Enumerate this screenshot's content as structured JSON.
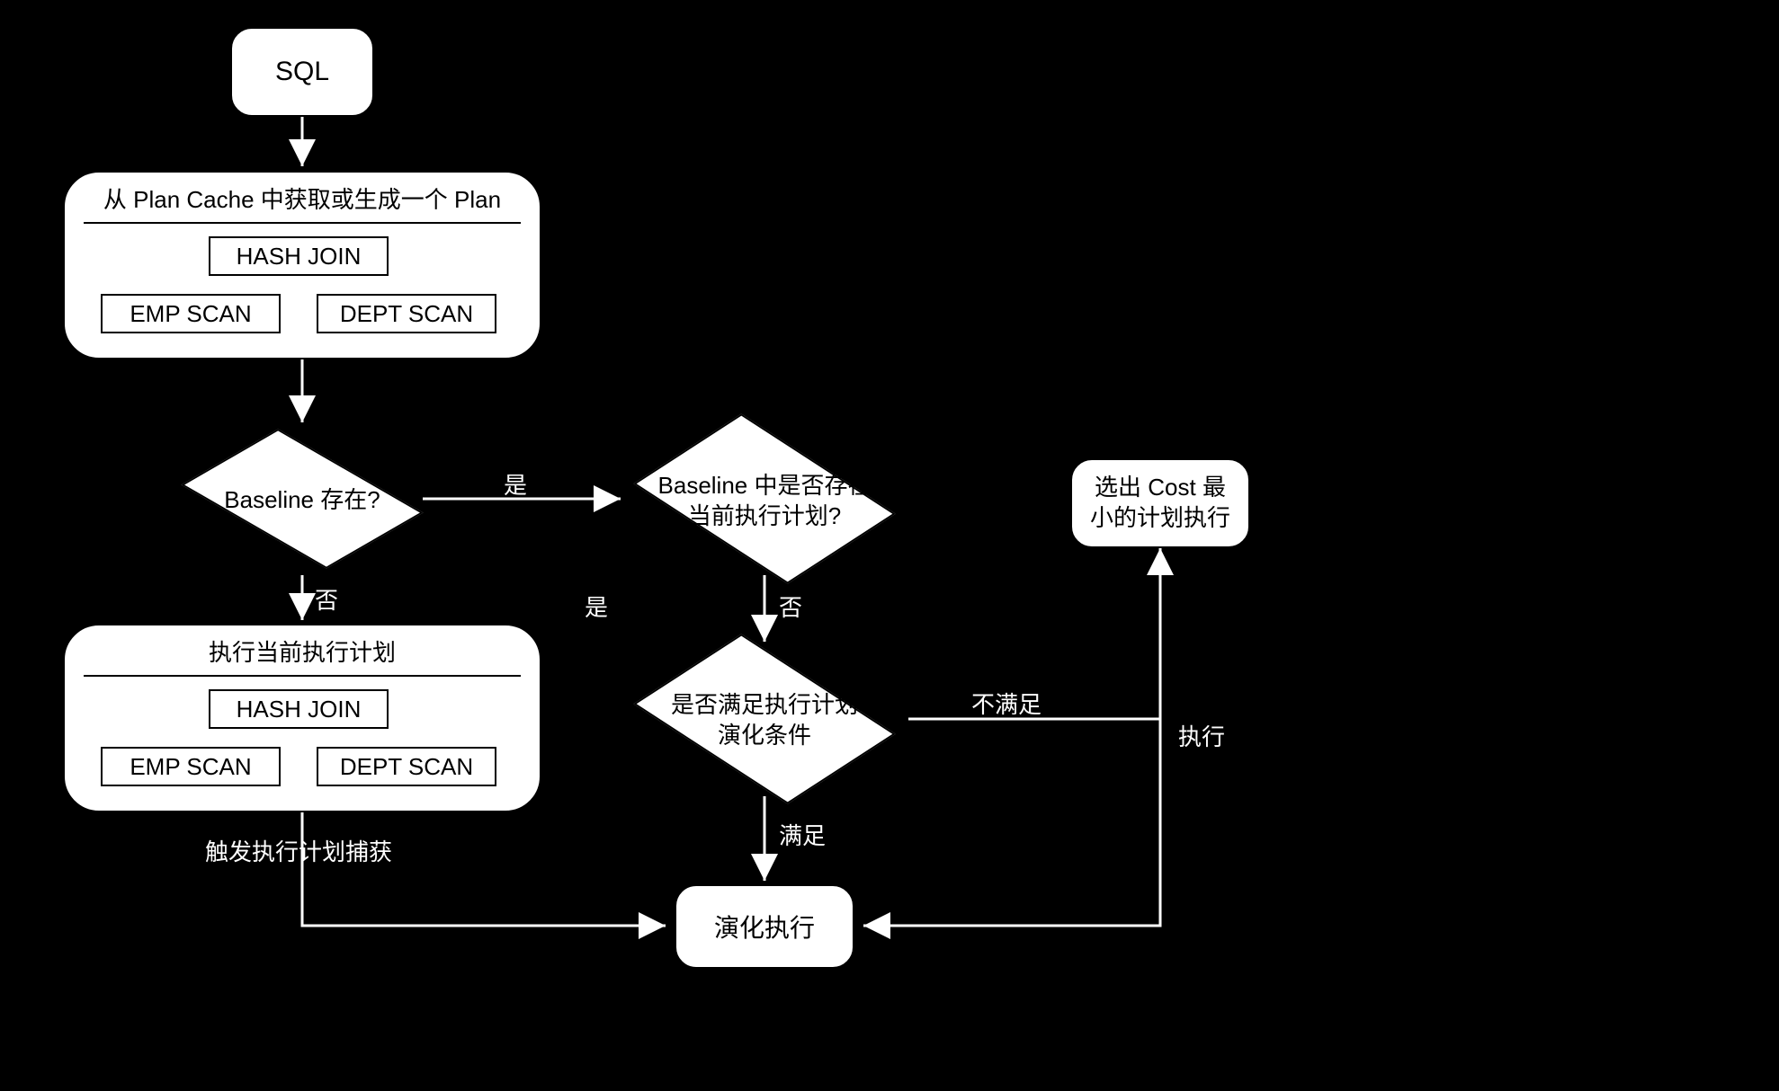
{
  "nodes": {
    "sql": "SQL",
    "plan_cache_title": "从 Plan Cache 中获取或生成一个 Plan",
    "hash_join": "HASH JOIN",
    "emp_scan": "EMP SCAN",
    "dept_scan": "DEPT SCAN",
    "baseline_exists": "Baseline 存在?",
    "exec_current_title": "执行当前执行计划",
    "baseline_has_plan": "Baseline 中是否存在\n当前执行计划?",
    "cond_evolve": "是否满足执行计划\n演化条件",
    "cost_min": "选出 Cost 最\n小的计划执行",
    "evolve_exec": "演化执行"
  },
  "edges": {
    "no": "否",
    "yes": "是",
    "no2": "否",
    "yes2": "是",
    "trigger": "触发执行计划捕获",
    "not_satisfy": "不满足",
    "execute": "执行",
    "satisfy": "满足"
  }
}
